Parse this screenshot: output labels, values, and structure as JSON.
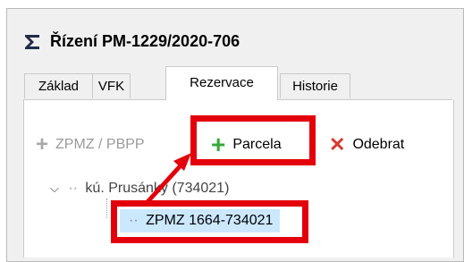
{
  "window": {
    "title": "Řízení PM-1229/2020-706",
    "title_icon": "sigma-icon"
  },
  "tabs": [
    {
      "label": "Základ",
      "active": false
    },
    {
      "label": "VFK",
      "active": false
    },
    {
      "label": "Rezervace",
      "active": true
    },
    {
      "label": "Historie",
      "active": false
    }
  ],
  "toolbar": {
    "zpmz_label": "ZPMZ / PBPP",
    "zpmz_icon": "plus-icon",
    "zpmz_enabled": false,
    "parcela_label": "Parcela",
    "parcela_icon": "plus-icon",
    "odebrat_label": "Odebrat",
    "odebrat_icon": "x-icon"
  },
  "tree": {
    "root_label": "kú. Prusánky (734021)",
    "root_expanded": true,
    "child_label": "ZPMZ 1664-734021",
    "child_selected": true
  },
  "colors": {
    "highlight": "#e3000b",
    "plus": "#37a83a",
    "remove": "#d83a2c",
    "selection": "#cce8ff"
  }
}
